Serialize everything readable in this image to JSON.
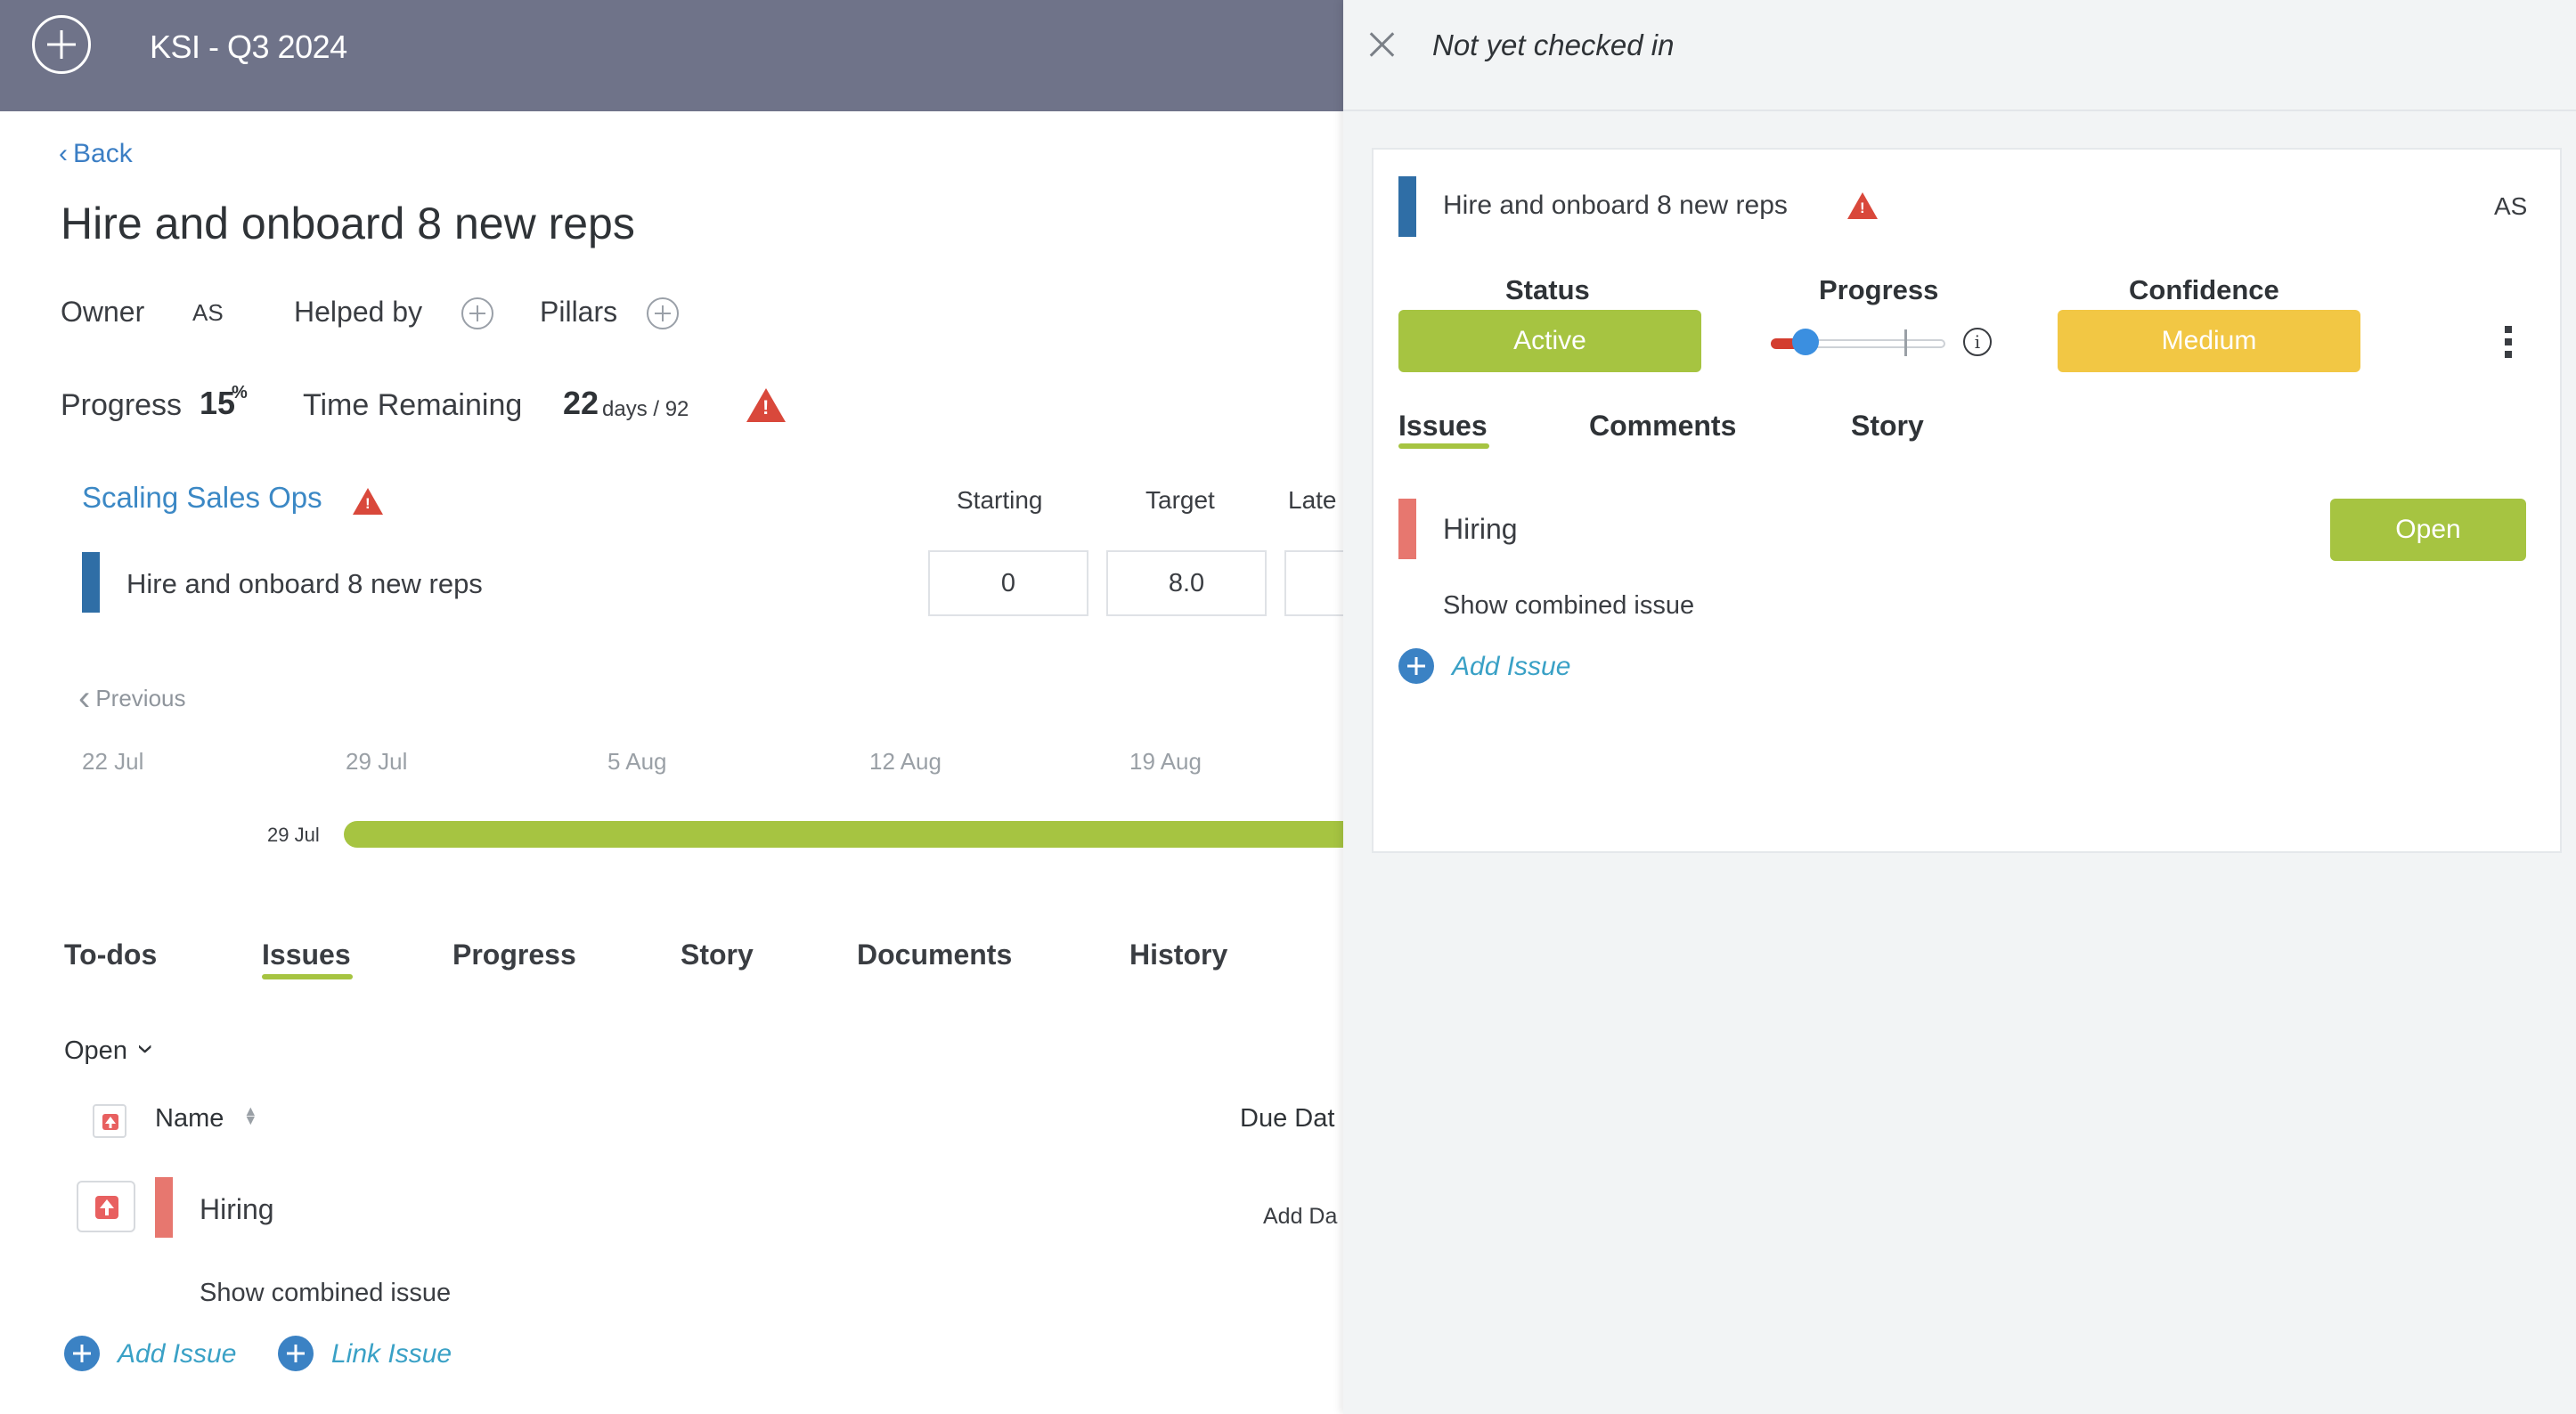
{
  "header": {
    "app_title": "KSI - Q3 2024"
  },
  "page": {
    "back_label": "Back",
    "title": "Hire and onboard 8 new reps",
    "owner_label": "Owner",
    "owner_initials": "AS",
    "helped_by_label": "Helped by",
    "pillars_label": "Pillars",
    "progress_label": "Progress",
    "progress_value": "15",
    "progress_unit": "%",
    "time_remaining_label": "Time Remaining",
    "time_remaining_value": "22",
    "time_remaining_total": "days / 92"
  },
  "pillar": {
    "name": "Scaling Sales Ops",
    "columns": [
      "Starting",
      "Target",
      "Late"
    ],
    "row_label": "Hire and onboard 8 new reps",
    "starting_value": "0",
    "target_value": "8.0"
  },
  "timeline": {
    "previous_label": "Previous",
    "dates": [
      "22 Jul",
      "29 Jul",
      "5 Aug",
      "12 Aug",
      "19 Aug"
    ],
    "bar_start_label": "29 Jul"
  },
  "tabs": [
    {
      "label": "To-dos"
    },
    {
      "label": "Issues"
    },
    {
      "label": "Progress"
    },
    {
      "label": "Story"
    },
    {
      "label": "Documents"
    },
    {
      "label": "History"
    }
  ],
  "issues_section": {
    "filter_label": "Open",
    "name_header": "Name",
    "due_header": "Due Dat",
    "issue_name": "Hiring",
    "add_date_label": "Add Da",
    "show_combined": "Show combined issue",
    "add_issue_label": "Add Issue",
    "link_issue_label": "Link Issue"
  },
  "panel": {
    "title": "Not yet checked in",
    "card_title": "Hire and onboard 8 new reps",
    "initials": "AS",
    "status_label": "Status",
    "status_value": "Active",
    "progress_label": "Progress",
    "progress_fraction": 0.15,
    "confidence_label": "Confidence",
    "confidence_value": "Medium",
    "tabs": [
      {
        "label": "Issues"
      },
      {
        "label": "Comments"
      },
      {
        "label": "Story"
      }
    ],
    "issue_name": "Hiring",
    "issue_status": "Open",
    "show_combined": "Show combined issue",
    "add_issue_label": "Add Issue",
    "info_glyph": "i"
  },
  "colors": {
    "topbar": "#6f7389",
    "accent_green": "#a6c441",
    "accent_yellow": "#f2c744",
    "warning_red": "#d9483b",
    "link_blue": "#3b88c5",
    "issue_salmon": "#e7776f"
  },
  "icons": {
    "add": "plus-circle-icon",
    "back": "chevron-left-icon",
    "warning": "warning-triangle-icon",
    "close": "close-icon",
    "info": "info-icon",
    "more": "kebab-menu-icon",
    "sort": "sort-icon",
    "dropdown": "chevron-down-icon"
  }
}
